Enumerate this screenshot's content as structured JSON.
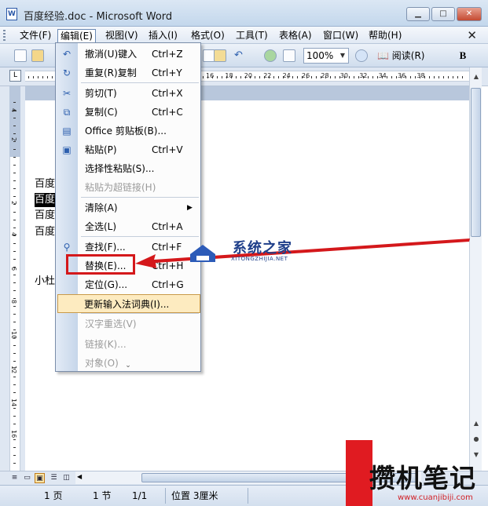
{
  "window": {
    "title": "百度经验.doc - Microsoft Word",
    "app_icon_letter": "W",
    "minimize_symbol": "▁",
    "maximize_symbol": "□",
    "close_symbol": "✕"
  },
  "menubar": {
    "items": [
      "文件(F)",
      "编辑(E)",
      "视图(V)",
      "插入(I)",
      "格式(O)",
      "工具(T)",
      "表格(A)",
      "窗口(W)",
      "帮助(H)"
    ],
    "active_index": 1,
    "doc_close_symbol": "✕"
  },
  "toolbar": {
    "zoom": "100%",
    "read_button": "阅读(R)",
    "bold": "B"
  },
  "ruler": {
    "tab_marker": "L",
    "numbers": [
      "16",
      "18",
      "20",
      "22",
      "24",
      "26",
      "28",
      "30",
      "32",
      "34",
      "36",
      "38"
    ]
  },
  "vruler": {
    "numbers": [
      "4",
      "2",
      "2",
      "4",
      "6",
      "8",
      "10",
      "12",
      "14",
      "16"
    ]
  },
  "document": {
    "lines": [
      {
        "text": "百度",
        "selected": false
      },
      {
        "text": "百度",
        "selected": true
      },
      {
        "text": "百度",
        "selected": false
      },
      {
        "text": "百度",
        "selected": false
      },
      {
        "text": "小杜",
        "selected": false
      }
    ]
  },
  "edit_menu": {
    "items": [
      {
        "icon": "undo-icon",
        "glyph": "↶",
        "label": "撤消(U)键入",
        "shortcut": "Ctrl+Z",
        "disabled": false
      },
      {
        "icon": "redo-icon",
        "glyph": "↻",
        "label": "重复(R)复制",
        "shortcut": "Ctrl+Y",
        "disabled": false
      },
      {
        "icon": "cut-icon",
        "glyph": "✂",
        "label": "剪切(T)",
        "shortcut": "Ctrl+X",
        "disabled": false
      },
      {
        "icon": "copy-icon",
        "glyph": "⧉",
        "label": "复制(C)",
        "shortcut": "Ctrl+C",
        "disabled": false
      },
      {
        "icon": "office-clipboard-icon",
        "glyph": "▤",
        "label": "Office 剪贴板(B)...",
        "shortcut": "",
        "disabled": false
      },
      {
        "icon": "paste-icon",
        "glyph": "▣",
        "label": "粘贴(P)",
        "shortcut": "Ctrl+V",
        "disabled": false
      },
      {
        "icon": "",
        "glyph": "",
        "label": "选择性粘贴(S)...",
        "shortcut": "",
        "disabled": false
      },
      {
        "icon": "",
        "glyph": "",
        "label": "粘贴为超链接(H)",
        "shortcut": "",
        "disabled": true
      },
      {
        "icon": "",
        "glyph": "",
        "label": "清除(A)",
        "shortcut": "",
        "disabled": false,
        "submenu": true
      },
      {
        "icon": "",
        "glyph": "",
        "label": "全选(L)",
        "shortcut": "Ctrl+A",
        "disabled": false
      },
      {
        "icon": "find-icon",
        "glyph": "⚲",
        "label": "查找(F)...",
        "shortcut": "Ctrl+F",
        "disabled": false
      },
      {
        "icon": "",
        "glyph": "",
        "label": "替换(E)...",
        "shortcut": "Ctrl+H",
        "disabled": false
      },
      {
        "icon": "",
        "glyph": "",
        "label": "定位(G)...",
        "shortcut": "Ctrl+G",
        "disabled": false
      },
      {
        "icon": "",
        "glyph": "",
        "label": "更新输入法词典(I)...",
        "shortcut": "",
        "disabled": false,
        "highlighted": true
      },
      {
        "icon": "",
        "glyph": "",
        "label": "汉字重选(V)",
        "shortcut": "",
        "disabled": true
      },
      {
        "icon": "",
        "glyph": "",
        "label": "链接(K)...",
        "shortcut": "",
        "disabled": true
      },
      {
        "icon": "",
        "glyph": "",
        "label": "对象(O)",
        "shortcut": "",
        "disabled": true
      }
    ],
    "expand_symbol": "⌄",
    "submenu_arrow": "▶"
  },
  "status": {
    "page": "1 页",
    "section": "1 节",
    "page_of": "1/1",
    "position": "位置 3厘米"
  },
  "watermarks": {
    "xitong_name": "系统之家",
    "xitong_url": "XITONGZHIJIA.NET",
    "cuanjibiji_name": "攒机笔记",
    "cuanjibiji_url": "www.cuanjibiji.com"
  },
  "colors": {
    "annotation_red": "#d4181b",
    "menu_highlight": "#fdebc0"
  }
}
